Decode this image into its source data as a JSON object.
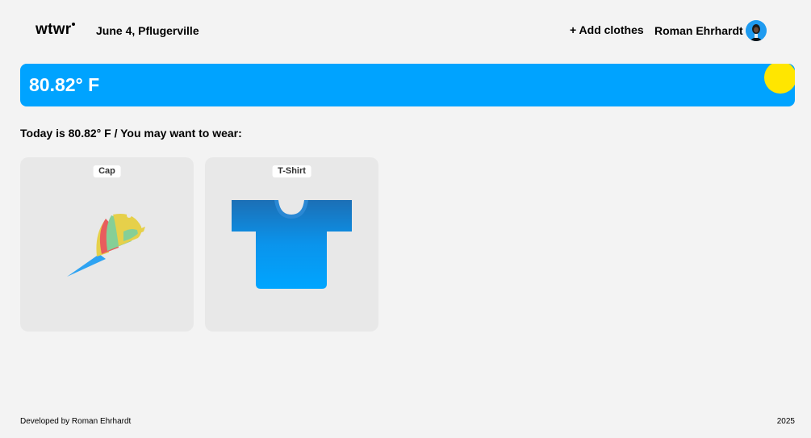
{
  "header": {
    "logo": "wtwr",
    "date_location": "June 4, Pflugerville",
    "add_clothes_label": "+ Add clothes",
    "username": "Roman Ehrhardt"
  },
  "weather": {
    "temperature": "80.82° F"
  },
  "main": {
    "recommendation": "Today is 80.82° F / You may want to wear:",
    "cards": [
      {
        "name": "Cap",
        "icon": "cap-icon"
      },
      {
        "name": "T-Shirt",
        "icon": "tshirt-icon"
      }
    ]
  },
  "footer": {
    "credit": "Developed by Roman Ehrhardt",
    "year": "2025"
  },
  "colors": {
    "background": "#f3f3f3",
    "banner": "#00a3ff",
    "sun": "#ffe600",
    "card": "#e8e8e8"
  }
}
